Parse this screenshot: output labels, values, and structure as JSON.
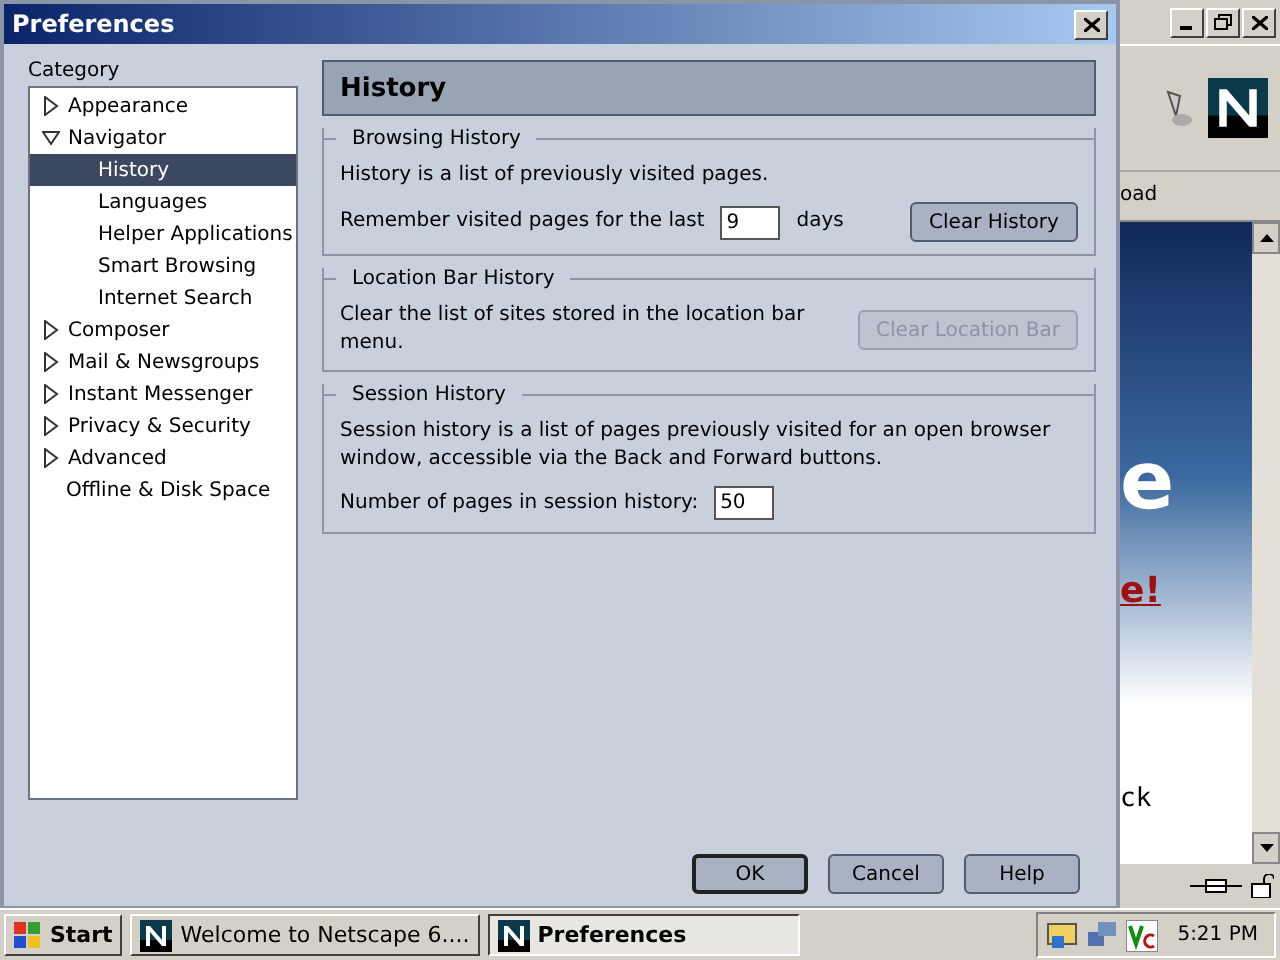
{
  "dialog": {
    "title": "Preferences",
    "category_label": "Category",
    "categories": [
      {
        "label": "Appearance",
        "expanded": false,
        "selected": false
      },
      {
        "label": "Navigator",
        "expanded": true,
        "selected": false,
        "children": [
          {
            "label": "History",
            "selected": true
          },
          {
            "label": "Languages",
            "selected": false
          },
          {
            "label": "Helper Applications",
            "selected": false
          },
          {
            "label": "Smart Browsing",
            "selected": false
          },
          {
            "label": "Internet Search",
            "selected": false
          }
        ]
      },
      {
        "label": "Composer",
        "expanded": false,
        "selected": false
      },
      {
        "label": "Mail & Newsgroups",
        "expanded": false,
        "selected": false
      },
      {
        "label": "Instant Messenger",
        "expanded": false,
        "selected": false
      },
      {
        "label": "Privacy & Security",
        "expanded": false,
        "selected": false
      },
      {
        "label": "Advanced",
        "expanded": false,
        "selected": false
      },
      {
        "label": "Offline & Disk Space",
        "selected": false
      }
    ],
    "panel_title": "History",
    "groups": [
      {
        "title": "Browsing History",
        "text": "History is a list of previously visited pages.",
        "field_label": "Remember visited pages for the last",
        "field_value": "9",
        "field_suffix": "days",
        "button": {
          "label": "Clear History",
          "disabled": false
        }
      },
      {
        "title": "Location Bar History",
        "text": "Clear the list of sites stored in the location bar menu.",
        "button": {
          "label": "Clear Location Bar",
          "disabled": true
        }
      },
      {
        "title": "Session History",
        "text": "Session history is a list of pages previously visited for an open browser window, accessible via the Back and Forward buttons.",
        "field_label": "Number of pages in session history:",
        "field_value": "50"
      }
    ],
    "buttons": [
      {
        "label": "OK",
        "default": true
      },
      {
        "label": "Cancel",
        "default": false
      },
      {
        "label": "Help",
        "default": false
      }
    ]
  },
  "background_window": {
    "texts": [
      "oad",
      "e",
      "e!",
      "ck"
    ]
  },
  "taskbar": {
    "start": "Start",
    "tasks": [
      {
        "label": "Welcome to Netscape 6....",
        "selected": false
      },
      {
        "label": "Preferences",
        "selected": true
      }
    ],
    "clock": "5:21 PM"
  }
}
